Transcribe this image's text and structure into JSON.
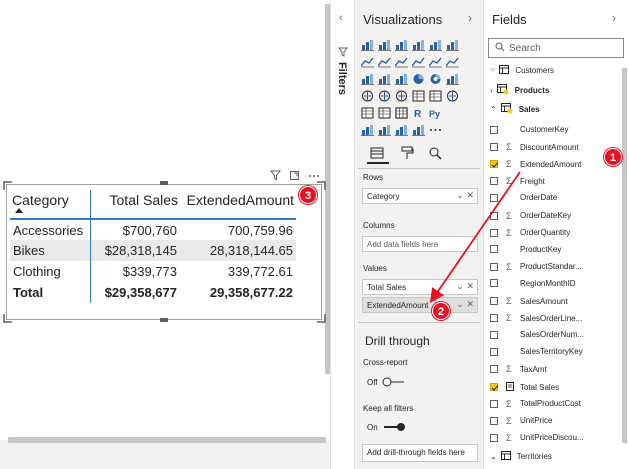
{
  "canvas": {
    "visual_header_icons": [
      "filter-icon",
      "focus-mode-icon",
      "more-options-icon"
    ],
    "matrix": {
      "columns": [
        "Category",
        "Total Sales",
        "ExtendedAmount"
      ],
      "rows": [
        {
          "category": "Accessories",
          "total_sales": "$700,760",
          "extended_amount": "700,759.96"
        },
        {
          "category": "Bikes",
          "total_sales": "$28,318,145",
          "extended_amount": "28,318,144.65"
        },
        {
          "category": "Clothing",
          "total_sales": "$339,773",
          "extended_amount": "339,772.61"
        }
      ],
      "total": {
        "category": "Total",
        "total_sales": "$29,358,677",
        "extended_amount": "29,358,677.22"
      }
    }
  },
  "badges": {
    "one": "1",
    "two": "2",
    "three": "3"
  },
  "filters": {
    "label": "Filters"
  },
  "visualizations": {
    "title": "Visualizations",
    "fields_icon": "fields-icon",
    "format_icon": "paint-roller-icon",
    "analytics_icon": "analytics-icon",
    "rows_label": "Rows",
    "rows_field": "Category",
    "columns_label": "Columns",
    "columns_placeholder": "Add data fields here",
    "values_label": "Values",
    "values_fields": [
      "Total Sales",
      "ExtendedAmount"
    ],
    "drill_through": "Drill through",
    "cross_report": "Cross-report",
    "cross_report_state": "Off",
    "keep_all_filters": "Keep all filters",
    "keep_all_filters_state": "On",
    "drill_placeholder": "Add drill-through fields here"
  },
  "fields": {
    "title": "Fields",
    "search_placeholder": "Search",
    "tables": [
      {
        "name": "Customers"
      },
      {
        "name": "Products"
      },
      {
        "name": "Sales"
      }
    ],
    "sales_fields": [
      {
        "name": "CustomerKey",
        "sigma": false,
        "checked": false
      },
      {
        "name": "DiscountAmount",
        "sigma": true,
        "checked": false
      },
      {
        "name": "ExtendedAmount",
        "sigma": true,
        "checked": true
      },
      {
        "name": "Freight",
        "sigma": true,
        "checked": false
      },
      {
        "name": "OrderDate",
        "sigma": false,
        "checked": false
      },
      {
        "name": "OrderDateKey",
        "sigma": true,
        "checked": false
      },
      {
        "name": "OrderQuantity",
        "sigma": true,
        "checked": false
      },
      {
        "name": "ProductKey",
        "sigma": false,
        "checked": false
      },
      {
        "name": "ProductStandar...",
        "sigma": true,
        "checked": false
      },
      {
        "name": "RegionMonthID",
        "sigma": false,
        "checked": false
      },
      {
        "name": "SalesAmount",
        "sigma": true,
        "checked": false
      },
      {
        "name": "SalesOrderLine...",
        "sigma": true,
        "checked": false
      },
      {
        "name": "SalesOrderNum...",
        "sigma": false,
        "checked": false
      },
      {
        "name": "SalesTerritoryKey",
        "sigma": false,
        "checked": false
      },
      {
        "name": "TaxAmt",
        "sigma": true,
        "checked": false
      },
      {
        "name": "Total Sales",
        "sigma": false,
        "checked": true
      },
      {
        "name": "TotalProductCost",
        "sigma": true,
        "checked": false
      },
      {
        "name": "UnitPrice",
        "sigma": true,
        "checked": false
      },
      {
        "name": "UnitPriceDiscou...",
        "sigma": true,
        "checked": false
      }
    ],
    "bottom_table": "Territories"
  },
  "colors": {
    "accent": "#2b7dc9",
    "badge": "#e81123",
    "arrow": "#e81123",
    "checked": "#f2c811"
  }
}
